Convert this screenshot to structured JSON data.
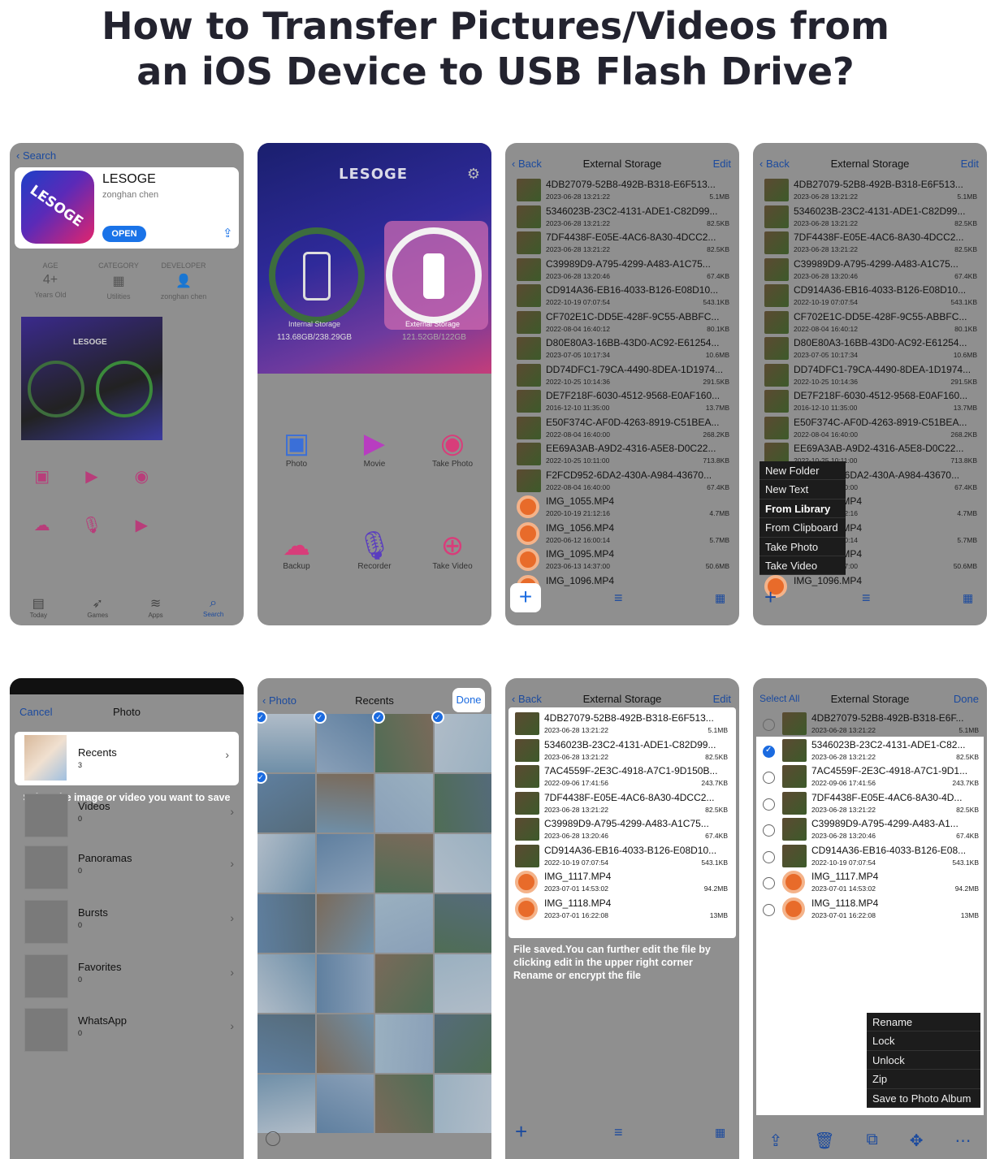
{
  "title_line1": "How to Transfer Pictures/Videos from",
  "title_line2": "an iOS Device to USB Flash Drive?",
  "appstore": {
    "back": "Search",
    "app_name": "LESOGE",
    "developer": "zonghan chen",
    "open": "OPEN",
    "info": [
      {
        "label": "AGE",
        "value": "4+",
        "sub": "Years Old"
      },
      {
        "label": "CATEGORY",
        "value": "▦",
        "sub": "Utilities"
      },
      {
        "label": "DEVELOPER",
        "value": "👤",
        "sub": "zonghan chen"
      }
    ],
    "tabs": [
      "Today",
      "Games",
      "Apps",
      "Search"
    ]
  },
  "lesoge_home": {
    "brand": "LESOGE",
    "internal_label": "Internal Storage",
    "internal_size": "113.68GB/238.29GB",
    "external_label": "External Storage",
    "external_size": "121.52GB/122GB",
    "actions": [
      "Photo",
      "Movie",
      "Take Photo",
      "Backup",
      "Recorder",
      "Take Video"
    ]
  },
  "ext_storage": {
    "back": "Back",
    "title": "External Storage",
    "edit": "Edit",
    "files": [
      {
        "name": "4DB27079-52B8-492B-B318-E6F513...",
        "date": "2023-06-28 13:21:22",
        "size": "5.1MB",
        "type": "img"
      },
      {
        "name": "5346023B-23C2-4131-ADE1-C82D99...",
        "date": "2023-06-28 13:21:22",
        "size": "82.5KB",
        "type": "img"
      },
      {
        "name": "7DF4438F-E05E-4AC6-8A30-4DCC2...",
        "date": "2023-06-28 13:21:22",
        "size": "82.5KB",
        "type": "img"
      },
      {
        "name": "C39989D9-A795-4299-A483-A1C75...",
        "date": "2023-06-28 13:20:46",
        "size": "67.4KB",
        "type": "img"
      },
      {
        "name": "CD914A36-EB16-4033-B126-E08D10...",
        "date": "2022-10-19 07:07:54",
        "size": "543.1KB",
        "type": "img"
      },
      {
        "name": "CF702E1C-DD5E-428F-9C55-ABBFC...",
        "date": "2022-08-04 16:40:12",
        "size": "80.1KB",
        "type": "img"
      },
      {
        "name": "D80E80A3-16BB-43D0-AC92-E61254...",
        "date": "2023-07-05 10:17:34",
        "size": "10.6MB",
        "type": "img"
      },
      {
        "name": "DD74DFC1-79CA-4490-8DEA-1D1974...",
        "date": "2022-10-25 10:14:36",
        "size": "291.5KB",
        "type": "img"
      },
      {
        "name": "DE7F218F-6030-4512-9568-E0AF160...",
        "date": "2016-12-10 11:35:00",
        "size": "13.7MB",
        "type": "img"
      },
      {
        "name": "E50F374C-AF0D-4263-8919-C51BEA...",
        "date": "2022-08-04 16:40:00",
        "size": "268.2KB",
        "type": "img"
      },
      {
        "name": "EE69A3AB-A9D2-4316-A5E8-D0C22...",
        "date": "2022-10-25 10:11:00",
        "size": "713.8KB",
        "type": "img"
      },
      {
        "name": "F2FCD952-6DA2-430A-A984-43670...",
        "date": "2022-08-04 16:40:00",
        "size": "67.4KB",
        "type": "img"
      },
      {
        "name": "IMG_1055.MP4",
        "date": "2020-10-19 21:12:16",
        "size": "4.7MB",
        "type": "mp4"
      },
      {
        "name": "IMG_1056.MP4",
        "date": "2020-06-12 16:00:14",
        "size": "5.7MB",
        "type": "mp4"
      },
      {
        "name": "IMG_1095.MP4",
        "date": "2023-06-13 14:37:00",
        "size": "50.6MB",
        "type": "mp4"
      },
      {
        "name": "IMG_1096.MP4",
        "date": "",
        "size": "",
        "type": "mp4"
      }
    ],
    "add_menu": [
      "New Folder",
      "New Text",
      "From Library",
      "From Clipboard",
      "Take Photo",
      "Take Video"
    ]
  },
  "photo_picker": {
    "cancel": "Cancel",
    "title": "Photo",
    "albums": [
      {
        "name": "Recents",
        "count": "3"
      },
      {
        "name": "Videos",
        "count": "0"
      },
      {
        "name": "Panoramas",
        "count": "0"
      },
      {
        "name": "Bursts",
        "count": "0"
      },
      {
        "name": "Favorites",
        "count": "0"
      },
      {
        "name": "WhatsApp",
        "count": "0"
      }
    ],
    "hint": "Select the image or video you want to save"
  },
  "recents": {
    "back": "Photo",
    "title": "Recents",
    "done": "Done"
  },
  "saved": {
    "files": [
      {
        "name": "4DB27079-52B8-492B-B318-E6F513...",
        "date": "2023-06-28 13:21:22",
        "size": "5.1MB",
        "type": "img"
      },
      {
        "name": "5346023B-23C2-4131-ADE1-C82D99...",
        "date": "2023-06-28 13:21:22",
        "size": "82.5KB",
        "type": "img"
      },
      {
        "name": "7AC4559F-2E3C-4918-A7C1-9D150B...",
        "date": "2022-09-06 17:41:56",
        "size": "243.7KB",
        "type": "img"
      },
      {
        "name": "7DF4438F-E05E-4AC6-8A30-4DCC2...",
        "date": "2023-06-28 13:21:22",
        "size": "82.5KB",
        "type": "img"
      },
      {
        "name": "C39989D9-A795-4299-A483-A1C75...",
        "date": "2023-06-28 13:20:46",
        "size": "67.4KB",
        "type": "img"
      },
      {
        "name": "CD914A36-EB16-4033-B126-E08D10...",
        "date": "2022-10-19 07:07:54",
        "size": "543.1KB",
        "type": "img"
      },
      {
        "name": "IMG_1117.MP4",
        "date": "2023-07-01 14:53:02",
        "size": "94.2MB",
        "type": "mp4"
      },
      {
        "name": "IMG_1118.MP4",
        "date": "2023-07-01 16:22:08",
        "size": "13MB",
        "type": "mp4"
      }
    ],
    "note": "File saved.You can further edit the file by clicking edit in the upper right corner Rename or encrypt the file"
  },
  "select_mode": {
    "select_all": "Select All",
    "title": "External Storage",
    "done": "Done",
    "files": [
      {
        "name": "4DB27079-52B8-492B-B318-E6F...",
        "date": "2023-06-28 13:21:22",
        "size": "5.1MB",
        "type": "img",
        "checked": false
      },
      {
        "name": "5346023B-23C2-4131-ADE1-C82...",
        "date": "2023-06-28 13:21:22",
        "size": "82.5KB",
        "type": "img",
        "checked": true
      },
      {
        "name": "7AC4559F-2E3C-4918-A7C1-9D1...",
        "date": "2022-09-06 17:41:56",
        "size": "243.7KB",
        "type": "img",
        "checked": false
      },
      {
        "name": "7DF4438F-E05E-4AC6-8A30-4D...",
        "date": "2023-06-28 13:21:22",
        "size": "82.5KB",
        "type": "img",
        "checked": false
      },
      {
        "name": "C39989D9-A795-4299-A483-A1...",
        "date": "2023-06-28 13:20:46",
        "size": "67.4KB",
        "type": "img",
        "checked": false
      },
      {
        "name": "CD914A36-EB16-4033-B126-E08...",
        "date": "2022-10-19 07:07:54",
        "size": "543.1KB",
        "type": "img",
        "checked": false
      },
      {
        "name": "IMG_1117.MP4",
        "date": "2023-07-01 14:53:02",
        "size": "94.2MB",
        "type": "mp4",
        "checked": false
      },
      {
        "name": "IMG_1118.MP4",
        "date": "2023-07-01 16:22:08",
        "size": "13MB",
        "type": "mp4",
        "checked": false
      }
    ],
    "action_menu": [
      "Rename",
      "Lock",
      "Unlock",
      "Zip",
      "Save to Photo Album"
    ]
  }
}
